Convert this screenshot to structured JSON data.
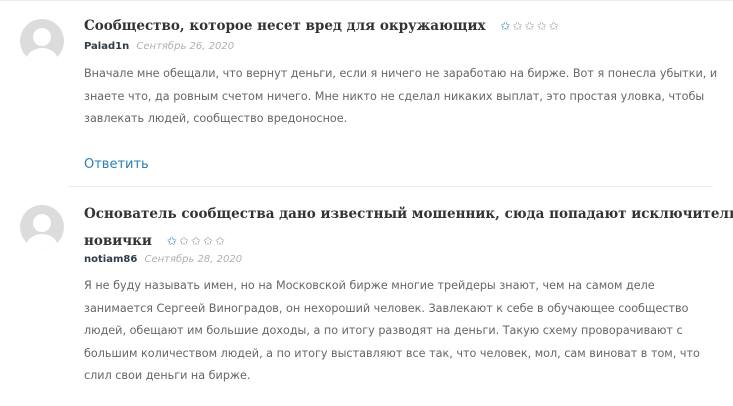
{
  "comments": [
    {
      "title": "Сообщество, которое несет вред для окружающих",
      "author": "Palad1n",
      "date": "Сентябрь 26, 2020",
      "rating": 1,
      "rating_max": 5,
      "text": "Вначале мне обещали, что вернут деньги, если я ничего не заработаю на бирже. Вот я понесла убытки, и знаете что, да ровным счетом ничего. Мне никто не сделал никаких выплат, это простая уловка, чтобы завлекать людей, сообщество вредоносное.",
      "reply_label": "Ответить"
    },
    {
      "title_line1": "Основатель сообщества дано известный мошенник, сюда попадают исключительно",
      "title_line2": "новички",
      "author": "notiam86",
      "date": "Сентябрь 28, 2020",
      "rating": 1,
      "rating_max": 5,
      "text": "Я не буду называть имен, но на Московской бирже многие трейдеры знают, чем на самом деле занимается Сергеей Виноградов, он нехороший человек. Завлекают к себе в обучающее сообщество людей, обещают им большие доходы, а по итогу разводят на деньги. Такую схему проворачивают с большим количеством людей, а по итогу выставляют все так, что человек, мол, сам виноват в том, что слил свои деньги на бирже."
    }
  ]
}
